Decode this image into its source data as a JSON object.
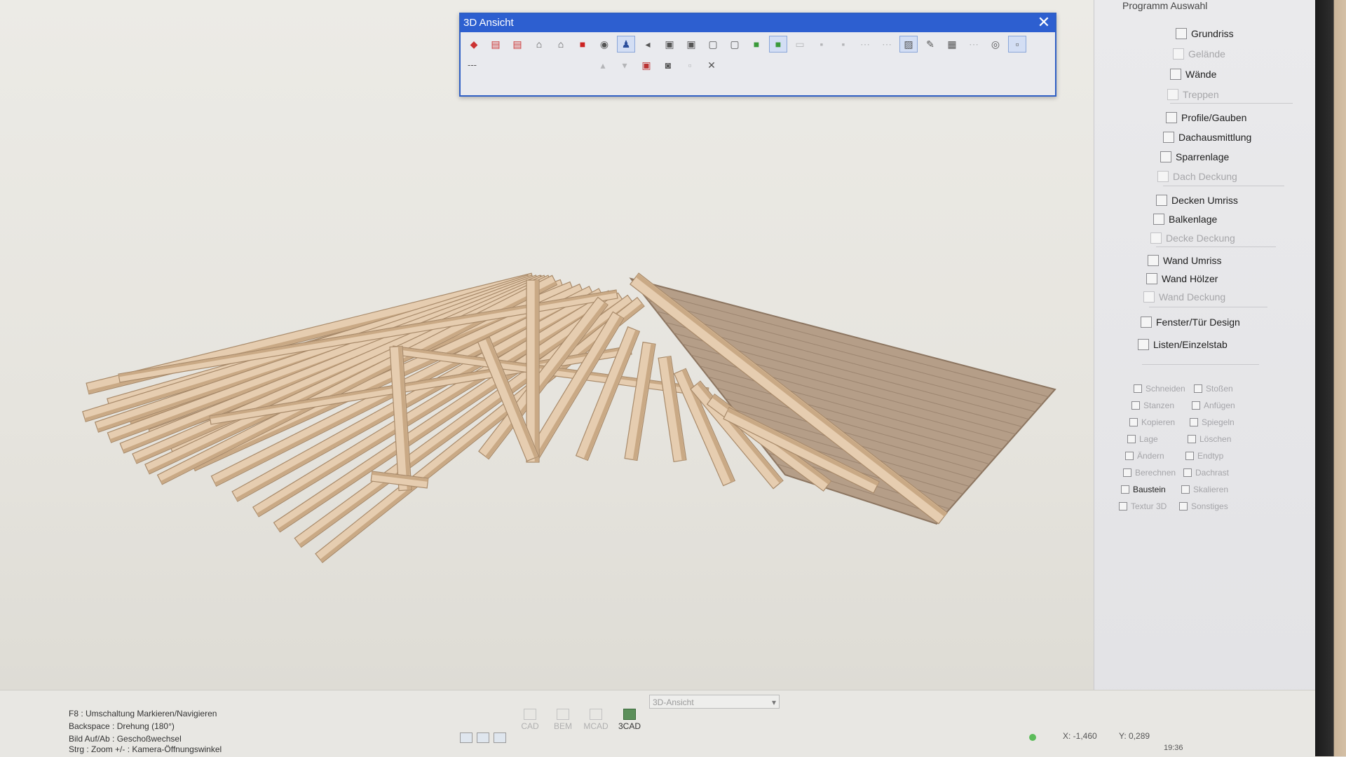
{
  "dialog": {
    "title": "3D Ansicht",
    "field_value": "---",
    "toolbar_row1": [
      {
        "icon": "red-cube-icon"
      },
      {
        "icon": "red-box-n-icon"
      },
      {
        "icon": "red-box-s-icon"
      },
      {
        "icon": "house-icon"
      },
      {
        "icon": "house-outline-icon"
      },
      {
        "icon": "red-square-icon"
      },
      {
        "icon": "house-eye-icon"
      },
      {
        "icon": "walk-icon",
        "selected": true
      },
      {
        "icon": "arrow-left-icon"
      },
      {
        "icon": "cube-wire-icon"
      },
      {
        "icon": "cube-side-icon"
      },
      {
        "icon": "cube-front-icon"
      },
      {
        "icon": "cube-top-icon"
      },
      {
        "icon": "green-cube-icon"
      },
      {
        "icon": "green-cube-sel-icon",
        "selected": true
      },
      {
        "icon": "sheet-icon",
        "disabled": true
      },
      {
        "icon": "camera-dim-icon",
        "disabled": true
      },
      {
        "icon": "camera-dim2-icon",
        "disabled": true
      },
      {
        "icon": "dots-icon",
        "disabled": true
      },
      {
        "icon": "dots2-icon",
        "disabled": true
      },
      {
        "icon": "hatch-icon",
        "selected": true
      },
      {
        "icon": "pencil-icon"
      },
      {
        "icon": "cube-grid-icon"
      },
      {
        "icon": "dots3-icon",
        "disabled": true
      },
      {
        "icon": "eye-dropdown-icon"
      },
      {
        "icon": "extra-icon",
        "selected": true
      }
    ],
    "toolbar_row2": [
      {
        "icon": "arrow-up-icon",
        "disabled": true
      },
      {
        "icon": "arrow-down-icon",
        "disabled": true
      },
      {
        "icon": "save-red-icon"
      },
      {
        "icon": "camera-icon"
      },
      {
        "icon": "blank-icon",
        "disabled": true
      },
      {
        "icon": "close-x-icon"
      }
    ]
  },
  "right_panel": {
    "header": "Programm Auswahl",
    "items": [
      {
        "label": "Grundriss",
        "enabled": true
      },
      {
        "label": "Gelände",
        "enabled": false
      },
      {
        "label": "Wände",
        "enabled": true
      },
      {
        "label": "Treppen",
        "enabled": false
      },
      {
        "label": "Profile/Gauben",
        "enabled": true
      },
      {
        "label": "Dachausmittlung",
        "enabled": true
      },
      {
        "label": "Sparrenlage",
        "enabled": true
      },
      {
        "label": "Dach Deckung",
        "enabled": false
      },
      {
        "label": "Decken Umriss",
        "enabled": true
      },
      {
        "label": "Balkenlage",
        "enabled": true
      },
      {
        "label": "Decke Deckung",
        "enabled": false
      },
      {
        "label": "Wand Umriss",
        "enabled": true
      },
      {
        "label": "Wand Hölzer",
        "enabled": true
      },
      {
        "label": "Wand Deckung",
        "enabled": false
      },
      {
        "label": "Fenster/Tür Design",
        "enabled": true
      },
      {
        "label": "Listen/Einzelstab",
        "enabled": true
      }
    ],
    "tools_left": [
      {
        "label": "Schneiden",
        "enabled": false
      },
      {
        "label": "Stanzen",
        "enabled": false
      },
      {
        "label": "Kopieren",
        "enabled": false
      },
      {
        "label": "Lage",
        "enabled": false
      },
      {
        "label": "Ändern",
        "enabled": false
      },
      {
        "label": "Berechnen",
        "enabled": false
      },
      {
        "label": "Baustein",
        "enabled": true
      },
      {
        "label": "Textur 3D",
        "enabled": false
      }
    ],
    "tools_right": [
      {
        "label": "Stoßen",
        "enabled": false
      },
      {
        "label": "Anfügen",
        "enabled": false
      },
      {
        "label": "Spiegeln",
        "enabled": false
      },
      {
        "label": "Löschen",
        "enabled": false
      },
      {
        "label": "Endtyp",
        "enabled": false
      },
      {
        "label": "Dachrast",
        "enabled": false
      },
      {
        "label": "Skalieren",
        "enabled": false
      },
      {
        "label": "Sonstiges",
        "enabled": false
      }
    ]
  },
  "statusbar": {
    "hints": [
      "F8 : Umschaltung Markieren/Navigieren",
      "Backspace : Drehung (180°)",
      "Bild Auf/Ab : Geschoßwechsel",
      "Strg : Zoom  +/- :  Kamera-Öffnungswinkel"
    ],
    "modes": [
      {
        "label": "CAD",
        "active": false
      },
      {
        "label": "BEM",
        "active": false
      },
      {
        "label": "MCAD",
        "active": false
      },
      {
        "label": "3CAD",
        "active": true
      }
    ],
    "view_select": "3D-Ansicht",
    "coord_x": "X: -1,460",
    "coord_y": "Y: 0,289",
    "clock": "19:36"
  },
  "colors": {
    "title_bar": "#2d5fd0",
    "timber": "#e6cdb0",
    "timber_shade": "#c9a985",
    "roof_sheathing": "#b39c86"
  }
}
